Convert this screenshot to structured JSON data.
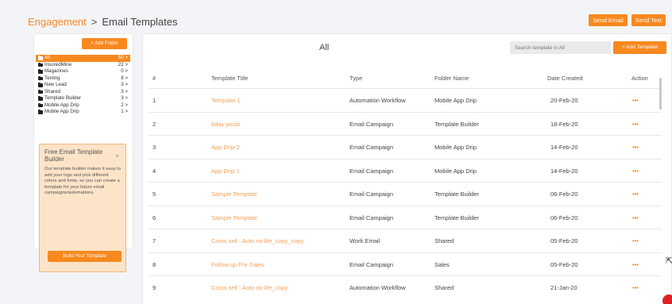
{
  "breadcrumb": {
    "section": "Engagement",
    "separator": ">",
    "page": "Email Templates"
  },
  "top_actions": {
    "send_email": "Send Email",
    "send_text": "Send Text"
  },
  "sidebar": {
    "add_folder": "+ Add Folder",
    "folders": [
      {
        "name": "All",
        "count": "50 >"
      },
      {
        "name": "InsuredMine",
        "count": "22 >"
      },
      {
        "name": "Magazines",
        "count": "0 >"
      },
      {
        "name": "Texting",
        "count": "8 >"
      },
      {
        "name": "New Lead",
        "count": "3 >"
      },
      {
        "name": "Shared",
        "count": "3 >"
      },
      {
        "name": "Template Builder",
        "count": "3 >"
      },
      {
        "name": "Mobile App Drip",
        "count": "2 >"
      },
      {
        "name": "Mobile App Drip",
        "count": "1 >"
      }
    ],
    "promo": {
      "title": "Free Email Template Builder",
      "close": "×",
      "text": "Our template builder makes it easy to add your logo and pick different colors and fonts, so you can create a template for your future email campaigns/automations.",
      "button": "Build Your Template"
    }
  },
  "main": {
    "title": "All",
    "search_placeholder": "Search template in All",
    "add_template": "+ Add Template",
    "columns": {
      "num": "#",
      "title": "Template Title",
      "type": "Type",
      "folder": "Folder Name",
      "date": "Date Created",
      "action": "Action"
    },
    "rows": [
      {
        "num": "1",
        "title": "Template 1",
        "type": "Automation Workflow",
        "folder": "Mobile App Drip",
        "date": "20-Feb-20",
        "action": "•••"
      },
      {
        "num": "2",
        "title": "bday jacob",
        "type": "Email Campaign",
        "folder": "Template Builder",
        "date": "18-Feb-20",
        "action": "•••"
      },
      {
        "num": "3",
        "title": "App Drip-2",
        "type": "Email Campaign",
        "folder": "Mobile App Drip",
        "date": "14-Feb-20",
        "action": "•••"
      },
      {
        "num": "4",
        "title": "App Drip-1",
        "type": "Email Campaign",
        "folder": "Mobile App Drip",
        "date": "14-Feb-20",
        "action": "•••"
      },
      {
        "num": "5",
        "title": "Sample Template",
        "type": "Email Campaign",
        "folder": "Template Builder",
        "date": "06-Feb-20",
        "action": "•••"
      },
      {
        "num": "6",
        "title": "Sample Template",
        "type": "Email Campaign",
        "folder": "Template Builder",
        "date": "06-Feb-20",
        "action": "•••"
      },
      {
        "num": "7",
        "title": "Cross sell : Auto no life_copy_copy",
        "type": "Work Email",
        "folder": "Shared",
        "date": "05-Feb-20",
        "action": "•••"
      },
      {
        "num": "8",
        "title": "Follow up Pre Sales",
        "type": "Email Campaign",
        "folder": "Sales",
        "date": "05-Feb-20",
        "action": "•••"
      },
      {
        "num": "9",
        "title": "Cross sell : Auto no life_copy",
        "type": "Automation Workflow",
        "folder": "Shared",
        "date": "21-Jan-20",
        "action": "•••"
      }
    ]
  },
  "colors": {
    "accent": "#f7891f",
    "link": "#f3a05a",
    "promo_bg": "#fde4c8"
  }
}
